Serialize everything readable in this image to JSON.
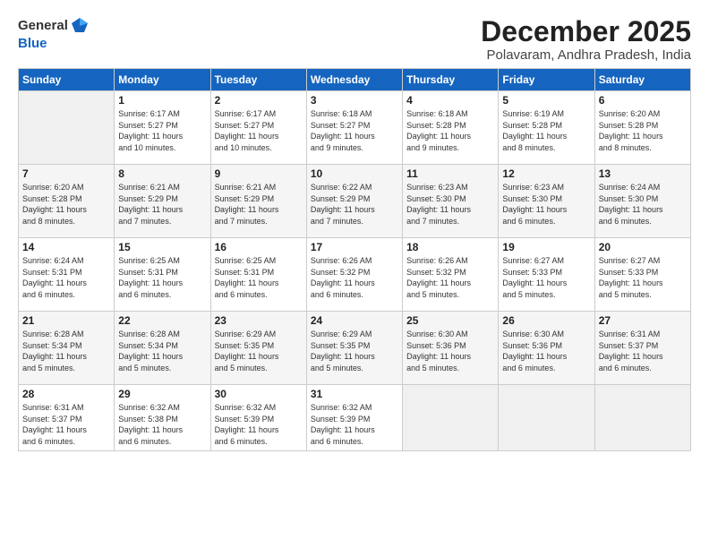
{
  "header": {
    "logo_general": "General",
    "logo_blue": "Blue",
    "month_title": "December 2025",
    "location": "Polavaram, Andhra Pradesh, India"
  },
  "weekdays": [
    "Sunday",
    "Monday",
    "Tuesday",
    "Wednesday",
    "Thursday",
    "Friday",
    "Saturday"
  ],
  "weeks": [
    [
      {
        "day": "",
        "info": ""
      },
      {
        "day": "1",
        "info": "Sunrise: 6:17 AM\nSunset: 5:27 PM\nDaylight: 11 hours\nand 10 minutes."
      },
      {
        "day": "2",
        "info": "Sunrise: 6:17 AM\nSunset: 5:27 PM\nDaylight: 11 hours\nand 10 minutes."
      },
      {
        "day": "3",
        "info": "Sunrise: 6:18 AM\nSunset: 5:27 PM\nDaylight: 11 hours\nand 9 minutes."
      },
      {
        "day": "4",
        "info": "Sunrise: 6:18 AM\nSunset: 5:28 PM\nDaylight: 11 hours\nand 9 minutes."
      },
      {
        "day": "5",
        "info": "Sunrise: 6:19 AM\nSunset: 5:28 PM\nDaylight: 11 hours\nand 8 minutes."
      },
      {
        "day": "6",
        "info": "Sunrise: 6:20 AM\nSunset: 5:28 PM\nDaylight: 11 hours\nand 8 minutes."
      }
    ],
    [
      {
        "day": "7",
        "info": "Sunrise: 6:20 AM\nSunset: 5:28 PM\nDaylight: 11 hours\nand 8 minutes."
      },
      {
        "day": "8",
        "info": "Sunrise: 6:21 AM\nSunset: 5:29 PM\nDaylight: 11 hours\nand 7 minutes."
      },
      {
        "day": "9",
        "info": "Sunrise: 6:21 AM\nSunset: 5:29 PM\nDaylight: 11 hours\nand 7 minutes."
      },
      {
        "day": "10",
        "info": "Sunrise: 6:22 AM\nSunset: 5:29 PM\nDaylight: 11 hours\nand 7 minutes."
      },
      {
        "day": "11",
        "info": "Sunrise: 6:23 AM\nSunset: 5:30 PM\nDaylight: 11 hours\nand 7 minutes."
      },
      {
        "day": "12",
        "info": "Sunrise: 6:23 AM\nSunset: 5:30 PM\nDaylight: 11 hours\nand 6 minutes."
      },
      {
        "day": "13",
        "info": "Sunrise: 6:24 AM\nSunset: 5:30 PM\nDaylight: 11 hours\nand 6 minutes."
      }
    ],
    [
      {
        "day": "14",
        "info": "Sunrise: 6:24 AM\nSunset: 5:31 PM\nDaylight: 11 hours\nand 6 minutes."
      },
      {
        "day": "15",
        "info": "Sunrise: 6:25 AM\nSunset: 5:31 PM\nDaylight: 11 hours\nand 6 minutes."
      },
      {
        "day": "16",
        "info": "Sunrise: 6:25 AM\nSunset: 5:31 PM\nDaylight: 11 hours\nand 6 minutes."
      },
      {
        "day": "17",
        "info": "Sunrise: 6:26 AM\nSunset: 5:32 PM\nDaylight: 11 hours\nand 6 minutes."
      },
      {
        "day": "18",
        "info": "Sunrise: 6:26 AM\nSunset: 5:32 PM\nDaylight: 11 hours\nand 5 minutes."
      },
      {
        "day": "19",
        "info": "Sunrise: 6:27 AM\nSunset: 5:33 PM\nDaylight: 11 hours\nand 5 minutes."
      },
      {
        "day": "20",
        "info": "Sunrise: 6:27 AM\nSunset: 5:33 PM\nDaylight: 11 hours\nand 5 minutes."
      }
    ],
    [
      {
        "day": "21",
        "info": "Sunrise: 6:28 AM\nSunset: 5:34 PM\nDaylight: 11 hours\nand 5 minutes."
      },
      {
        "day": "22",
        "info": "Sunrise: 6:28 AM\nSunset: 5:34 PM\nDaylight: 11 hours\nand 5 minutes."
      },
      {
        "day": "23",
        "info": "Sunrise: 6:29 AM\nSunset: 5:35 PM\nDaylight: 11 hours\nand 5 minutes."
      },
      {
        "day": "24",
        "info": "Sunrise: 6:29 AM\nSunset: 5:35 PM\nDaylight: 11 hours\nand 5 minutes."
      },
      {
        "day": "25",
        "info": "Sunrise: 6:30 AM\nSunset: 5:36 PM\nDaylight: 11 hours\nand 5 minutes."
      },
      {
        "day": "26",
        "info": "Sunrise: 6:30 AM\nSunset: 5:36 PM\nDaylight: 11 hours\nand 6 minutes."
      },
      {
        "day": "27",
        "info": "Sunrise: 6:31 AM\nSunset: 5:37 PM\nDaylight: 11 hours\nand 6 minutes."
      }
    ],
    [
      {
        "day": "28",
        "info": "Sunrise: 6:31 AM\nSunset: 5:37 PM\nDaylight: 11 hours\nand 6 minutes."
      },
      {
        "day": "29",
        "info": "Sunrise: 6:32 AM\nSunset: 5:38 PM\nDaylight: 11 hours\nand 6 minutes."
      },
      {
        "day": "30",
        "info": "Sunrise: 6:32 AM\nSunset: 5:39 PM\nDaylight: 11 hours\nand 6 minutes."
      },
      {
        "day": "31",
        "info": "Sunrise: 6:32 AM\nSunset: 5:39 PM\nDaylight: 11 hours\nand 6 minutes."
      },
      {
        "day": "",
        "info": ""
      },
      {
        "day": "",
        "info": ""
      },
      {
        "day": "",
        "info": ""
      }
    ]
  ]
}
